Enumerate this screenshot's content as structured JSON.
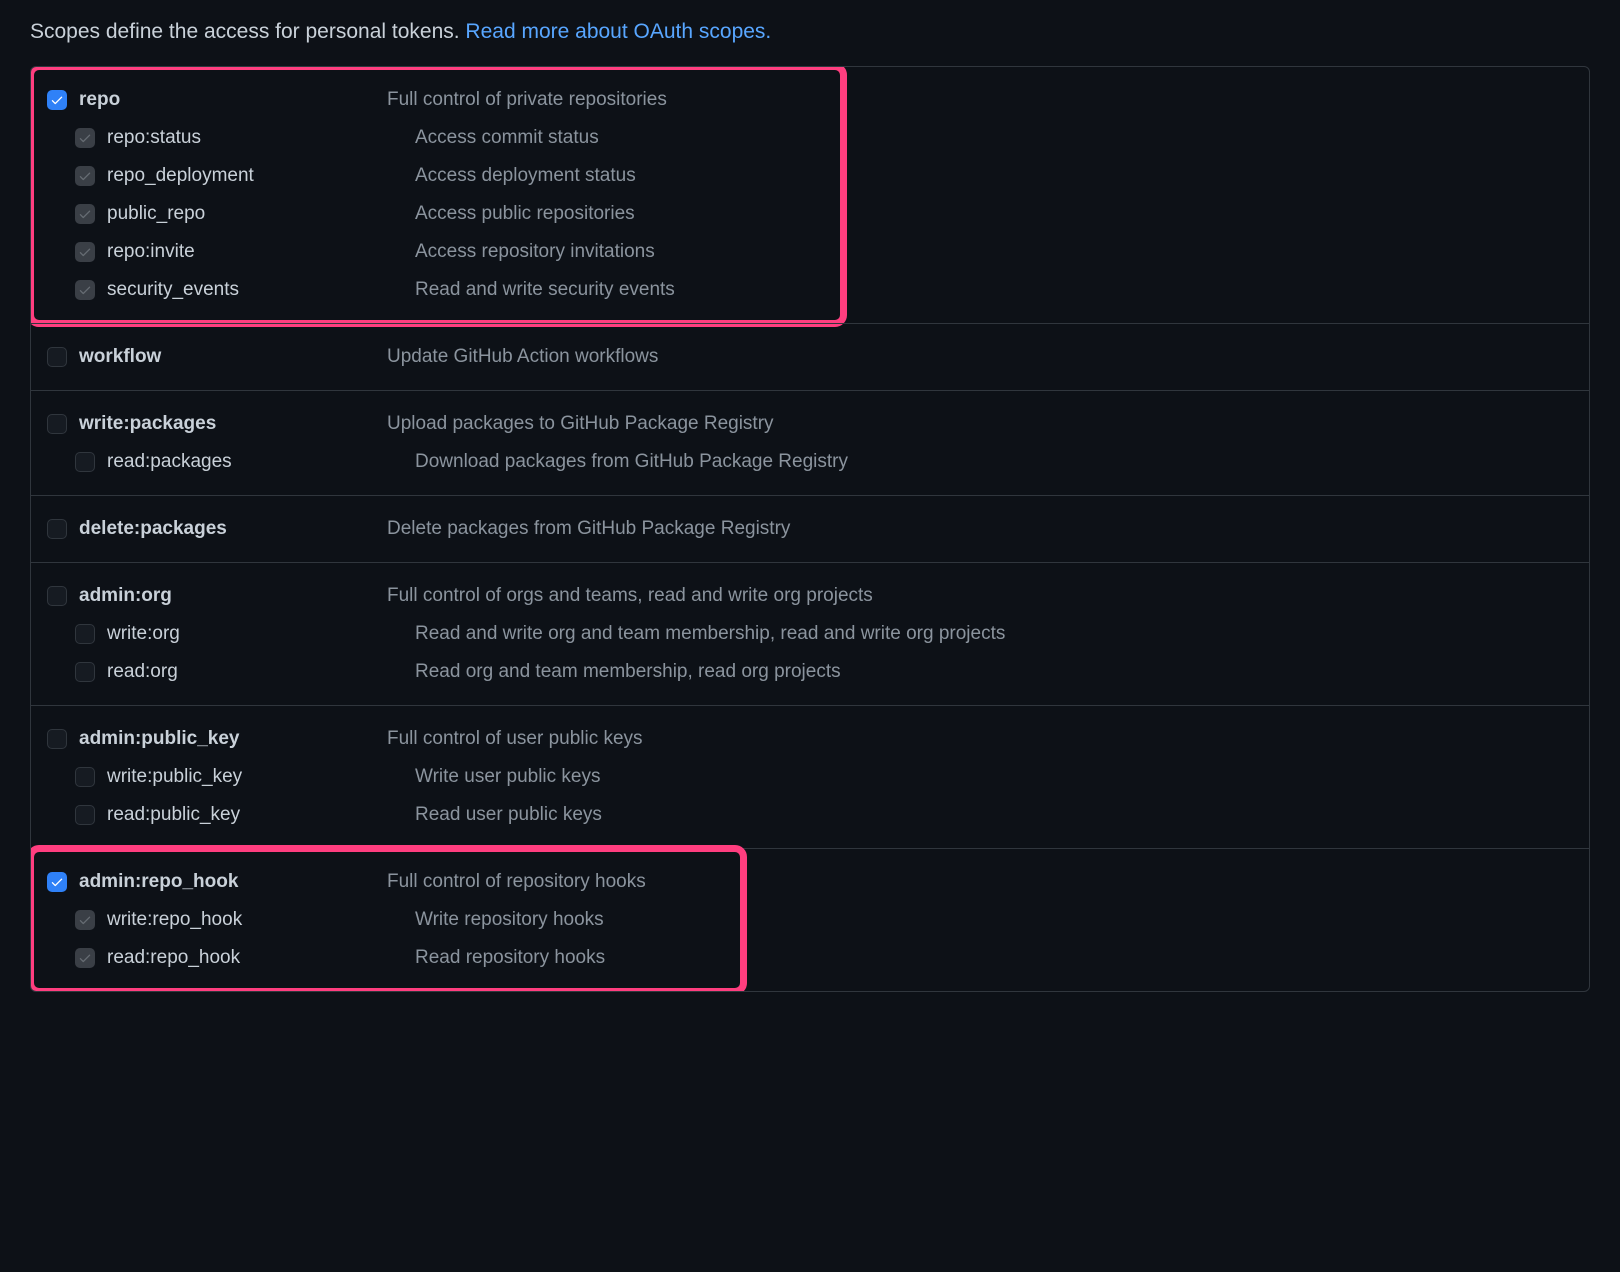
{
  "intro": {
    "text": "Scopes define the access for personal tokens. ",
    "link_text": "Read more about OAuth scopes."
  },
  "scope_groups": [
    {
      "highlight": true,
      "parent": {
        "name": "repo",
        "desc": "Full control of private repositories",
        "state": "checked-direct"
      },
      "children": [
        {
          "name": "repo:status",
          "desc": "Access commit status",
          "state": "checked-implied"
        },
        {
          "name": "repo_deployment",
          "desc": "Access deployment status",
          "state": "checked-implied"
        },
        {
          "name": "public_repo",
          "desc": "Access public repositories",
          "state": "checked-implied"
        },
        {
          "name": "repo:invite",
          "desc": "Access repository invitations",
          "state": "checked-implied"
        },
        {
          "name": "security_events",
          "desc": "Read and write security events",
          "state": "checked-implied"
        }
      ]
    },
    {
      "highlight": false,
      "parent": {
        "name": "workflow",
        "desc": "Update GitHub Action workflows",
        "state": "unchecked"
      },
      "children": []
    },
    {
      "highlight": false,
      "parent": {
        "name": "write:packages",
        "desc": "Upload packages to GitHub Package Registry",
        "state": "unchecked"
      },
      "children": [
        {
          "name": "read:packages",
          "desc": "Download packages from GitHub Package Registry",
          "state": "unchecked"
        }
      ]
    },
    {
      "highlight": false,
      "parent": {
        "name": "delete:packages",
        "desc": "Delete packages from GitHub Package Registry",
        "state": "unchecked"
      },
      "children": []
    },
    {
      "highlight": false,
      "parent": {
        "name": "admin:org",
        "desc": "Full control of orgs and teams, read and write org projects",
        "state": "unchecked"
      },
      "children": [
        {
          "name": "write:org",
          "desc": "Read and write org and team membership, read and write org projects",
          "state": "unchecked"
        },
        {
          "name": "read:org",
          "desc": "Read org and team membership, read org projects",
          "state": "unchecked"
        }
      ]
    },
    {
      "highlight": false,
      "parent": {
        "name": "admin:public_key",
        "desc": "Full control of user public keys",
        "state": "unchecked"
      },
      "children": [
        {
          "name": "write:public_key",
          "desc": "Write user public keys",
          "state": "unchecked"
        },
        {
          "name": "read:public_key",
          "desc": "Read user public keys",
          "state": "unchecked"
        }
      ]
    },
    {
      "highlight": true,
      "parent": {
        "name": "admin:repo_hook",
        "desc": "Full control of repository hooks",
        "state": "checked-direct"
      },
      "children": [
        {
          "name": "write:repo_hook",
          "desc": "Write repository hooks",
          "state": "checked-implied"
        },
        {
          "name": "read:repo_hook",
          "desc": "Read repository hooks",
          "state": "checked-implied"
        }
      ]
    }
  ],
  "highlight_widths": [
    820,
    720
  ]
}
